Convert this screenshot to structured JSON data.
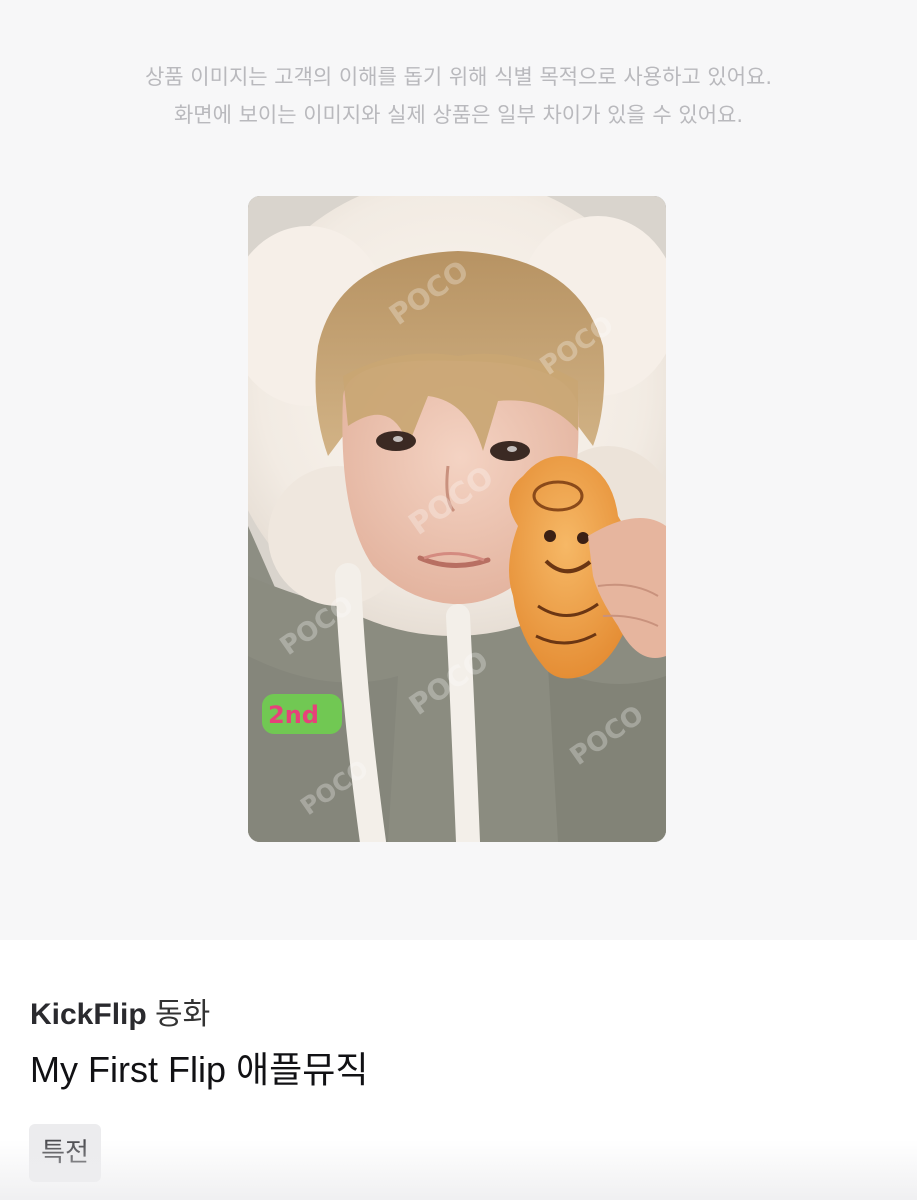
{
  "disclaimer": {
    "line1": "상품 이미지는 고객의 이해를 돕기 위해 식별 목적으로 사용하고 있어요.",
    "line2": "화면에 보이는 이미지와 실제 상품은 일부 차이가 있을 수 있어요."
  },
  "photo": {
    "watermark": "POCO",
    "hoodie_text": "2nd"
  },
  "product": {
    "artist": "KickFlip",
    "member": "동화",
    "title_en": "My First Flip",
    "title_ko": "애플뮤직"
  },
  "tags": [
    {
      "label": "특전"
    }
  ],
  "colors": {
    "background": "#f7f7f8",
    "disclaimer_text": "#b9b9bd",
    "tag_bg": "#ececee"
  }
}
